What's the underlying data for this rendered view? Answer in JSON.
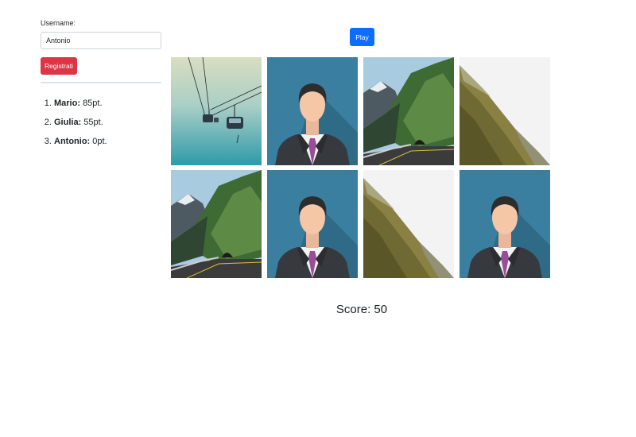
{
  "sidebar": {
    "username_label": "Username:",
    "username_value": "Antonio",
    "register_button_label": "Registrati",
    "leaderboard": [
      {
        "name": "Mario:",
        "score": "85pt."
      },
      {
        "name": "Giulia:",
        "score": "55pt."
      },
      {
        "name": "Antonio:",
        "score": "0pt."
      }
    ]
  },
  "game": {
    "play_button_label": "Play",
    "score_label": "Score:",
    "score_value": "50",
    "cards": [
      {
        "image": "cable-car-image"
      },
      {
        "image": "businessman-avatar-image"
      },
      {
        "image": "mountain-road-tunnel-image"
      },
      {
        "image": "misty-forest-slope-image"
      },
      {
        "image": "mountain-road-tunnel-image"
      },
      {
        "image": "businessman-avatar-image"
      },
      {
        "image": "misty-forest-slope-image"
      },
      {
        "image": "businessman-avatar-image"
      }
    ]
  },
  "colors": {
    "register_button": "#dc3545",
    "play_button": "#0d6efd",
    "avatar_background": "#3a7fa0"
  }
}
